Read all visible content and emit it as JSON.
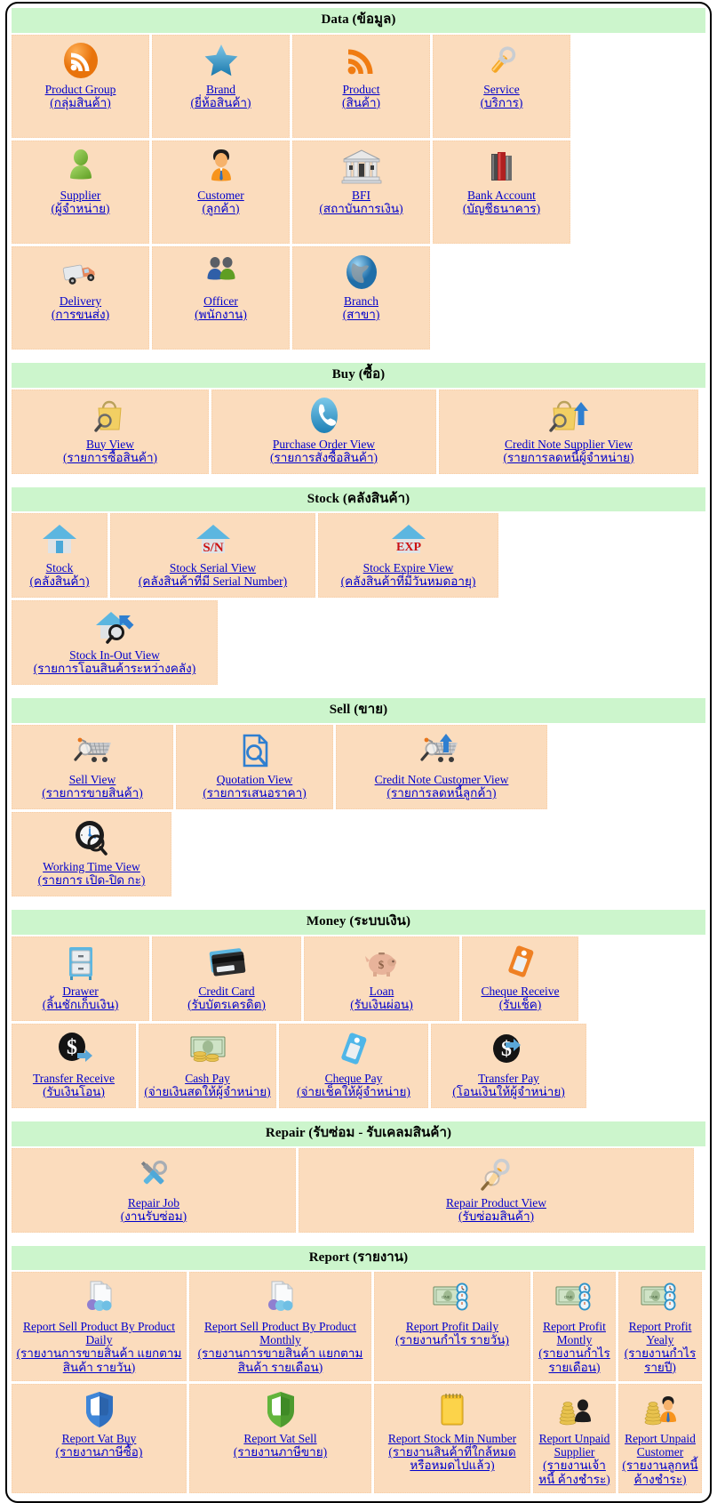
{
  "sections": [
    {
      "id": "data",
      "title": "Data (ข้อมูล)",
      "items": [
        {
          "icon": "rss-orange-icon",
          "en": "Product Group",
          "th": "(กลุ่มสินค้า)"
        },
        {
          "icon": "star-blue-icon",
          "en": "Brand",
          "th": "(ยี่ห้อสินค้า)"
        },
        {
          "icon": "rss-signal-icon",
          "en": "Product",
          "th": "(สินค้า)"
        },
        {
          "icon": "wrench-icon",
          "en": "Service",
          "th": "(บริการ)"
        },
        {
          "icon": "person-green-icon",
          "en": "Supplier",
          "th": "(ผู้จำหน่าย)"
        },
        {
          "icon": "customer-person-icon",
          "en": "Customer",
          "th": "(ลูกค้า)"
        },
        {
          "icon": "bank-building-icon",
          "en": "BFI",
          "th": "(สถาบันการเงิน)"
        },
        {
          "icon": "books-icon",
          "en": "Bank Account",
          "th": "(บัญชีธนาคาร)"
        },
        {
          "icon": "truck-icon",
          "en": "Delivery",
          "th": "(การขนส่ง)"
        },
        {
          "icon": "two-people-icon",
          "en": "Officer",
          "th": "(พนักงาน)"
        },
        {
          "icon": "globe-icon",
          "en": "Branch",
          "th": "(สาขา)"
        }
      ]
    },
    {
      "id": "buy",
      "title": "Buy (ซื้อ)",
      "items": [
        {
          "icon": "bag-magnifier-icon",
          "en": "Buy View",
          "th": "(รายการซื้อสินค้า)"
        },
        {
          "icon": "phone-blue-icon",
          "en": "Purchase Order View",
          "th": "(รายการสั่งซื้อสินค้า)"
        },
        {
          "icon": "bag-magnifier-arrow-icon",
          "en": "Credit Note Supplier View",
          "th": "(รายการลดหนี้ผู้จำหน่าย)"
        }
      ]
    },
    {
      "id": "stock",
      "title": "Stock (คลังสินค้า)",
      "items": [
        {
          "icon": "house-icon",
          "en": "Stock",
          "th": "(คลังสินค้า)"
        },
        {
          "icon": "house-sn-icon",
          "en": "Stock Serial View",
          "th": "(คลังสินค้าที่มี Serial Number)"
        },
        {
          "icon": "house-exp-icon",
          "en": "Stock Expire View",
          "th": "(คลังสินค้าที่มีวันหมดอายุ)"
        },
        {
          "icon": "house-magnifier-icon",
          "en": "Stock In-Out View",
          "th": "(รายการโอนสินค้าระหว่างคลัง)"
        }
      ]
    },
    {
      "id": "sell",
      "title": "Sell (ขาย)",
      "items": [
        {
          "icon": "cart-magnifier-icon",
          "en": "Sell View",
          "th": "(รายการขายสินค้า)"
        },
        {
          "icon": "document-magnifier-icon",
          "en": "Quotation View",
          "th": "(รายการเสนอราคา)"
        },
        {
          "icon": "cart-arrow-icon",
          "en": "Credit Note Customer View",
          "th": "(รายการลดหนี้ลูกค้า)"
        },
        {
          "icon": "clock-magnifier-icon",
          "en": "Working Time View",
          "th": "(รายการ เปิด-ปิด กะ)"
        }
      ]
    },
    {
      "id": "money",
      "title": "Money (ระบบเงิน)",
      "items": [
        {
          "icon": "cabinet-drawer-icon",
          "en": "Drawer",
          "th": "(ลิ้นชักเก็บเงิน)"
        },
        {
          "icon": "credit-card-icon",
          "en": "Credit Card",
          "th": "(รับบัตรเครดิต)"
        },
        {
          "icon": "piggy-bank-icon",
          "en": "Loan",
          "th": "(รับเงินผ่อน)"
        },
        {
          "icon": "tag-orange-icon",
          "en": "Cheque Receive",
          "th": "(รับเช็ค)"
        },
        {
          "icon": "coin-arrow-in-icon",
          "en": "Transfer Receive",
          "th": "(รับเงินโอน)"
        },
        {
          "icon": "cash-stack-icon",
          "en": "Cash Pay",
          "th": "(จ่ายเงินสดให้ผู้จำหน่าย)"
        },
        {
          "icon": "tag-blue-icon",
          "en": "Cheque Pay",
          "th": "(จ่ายเช็คให้ผู้จำหน่าย)"
        },
        {
          "icon": "coin-arrow-out-icon",
          "en": "Transfer Pay",
          "th": "(โอนเงินให้ผู้จำหน่าย)"
        }
      ]
    },
    {
      "id": "repair",
      "title": "Repair (รับซ่อม - รับเคลมสินค้า)",
      "items": [
        {
          "icon": "wrench-screwdriver-icon",
          "en": "Repair Job",
          "th": "(งานรับซ่อม)"
        },
        {
          "icon": "wrench-magnifier-icon",
          "en": "Repair Product View",
          "th": "(รับซ่อมสินค้า)"
        }
      ]
    },
    {
      "id": "report",
      "title": "Report (รายงาน)",
      "items": [
        {
          "icon": "document-spheres-icon",
          "en": "Report Sell Product By Product Daily",
          "th": "(รายงานการขายสินค้า แยกตามสินค้า รายวัน)"
        },
        {
          "icon": "document-spheres-icon",
          "en": "Report Sell Product By Product Monthly",
          "th": "(รายงานการขายสินค้า แยกตามสินค้า รายเดือน)"
        },
        {
          "icon": "banknote-clock-icon",
          "en": "Report Profit Daily",
          "th": "(รายงานกำไร รายวัน)"
        },
        {
          "icon": "banknote-clock-icon",
          "en": "Report Profit Montly",
          "th": "(รายงานกำไร รายเดือน)"
        },
        {
          "icon": "banknote-clock-icon",
          "en": "Report Profit Yealy",
          "th": "(รายงานกำไร รายปี)"
        },
        {
          "icon": "shield-blue-icon",
          "en": "Report Vat Buy",
          "th": "(รายงานภาษีซื้อ)"
        },
        {
          "icon": "shield-green-icon",
          "en": "Report Vat Sell",
          "th": "(รายงานภาษีขาย)"
        },
        {
          "icon": "notepad-icon",
          "en": "Report Stock Min Number",
          "th": "(รายงานสินค้าที่ใกล้หมด หรือหมดไปแล้ว)"
        },
        {
          "icon": "coins-person-dark-icon",
          "en": "Report Unpaid Supplier",
          "th": "(รายงานเจ้าหนี้ ค้างชำระ)"
        },
        {
          "icon": "coins-person-icon",
          "en": "Report Unpaid Customer",
          "th": "(รายงานลูกหนี้ ค้างชำระ)"
        }
      ]
    }
  ],
  "colors": {
    "header_bg": "#ccf5cc",
    "cell_bg": "#fbdcbd",
    "link": "#0000cc",
    "frame_border": "#000000"
  }
}
